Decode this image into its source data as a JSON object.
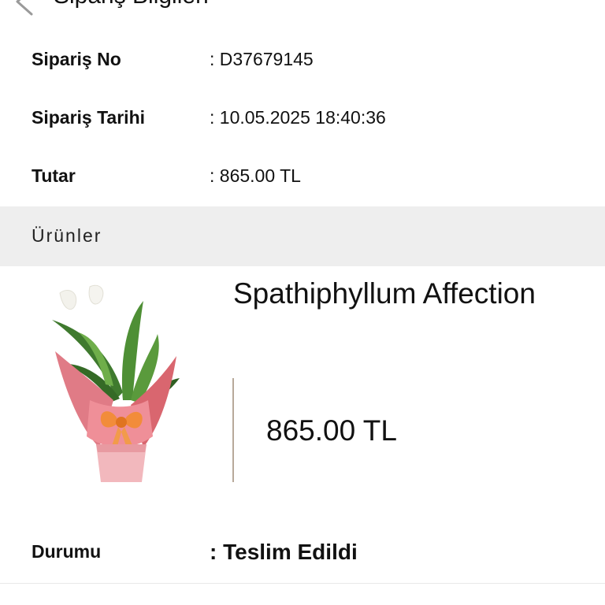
{
  "header": {
    "title": "Sipariş Bilgileri",
    "back_icon": "chevron-left-icon"
  },
  "order": {
    "rows": [
      {
        "label": "Sipariş No",
        "value": ": D37679145"
      },
      {
        "label": "Sipariş Tarihi",
        "value": ": 10.05.2025 18:40:36"
      },
      {
        "label": "Tutar",
        "value": ": 865.00 TL"
      }
    ]
  },
  "products": {
    "section_title": "Ürünler",
    "items": [
      {
        "name": "Spathiphyllum Affection",
        "price": "865.00 TL"
      }
    ]
  },
  "status": {
    "label": "Durumu",
    "value": ": Teslim Edildi"
  }
}
